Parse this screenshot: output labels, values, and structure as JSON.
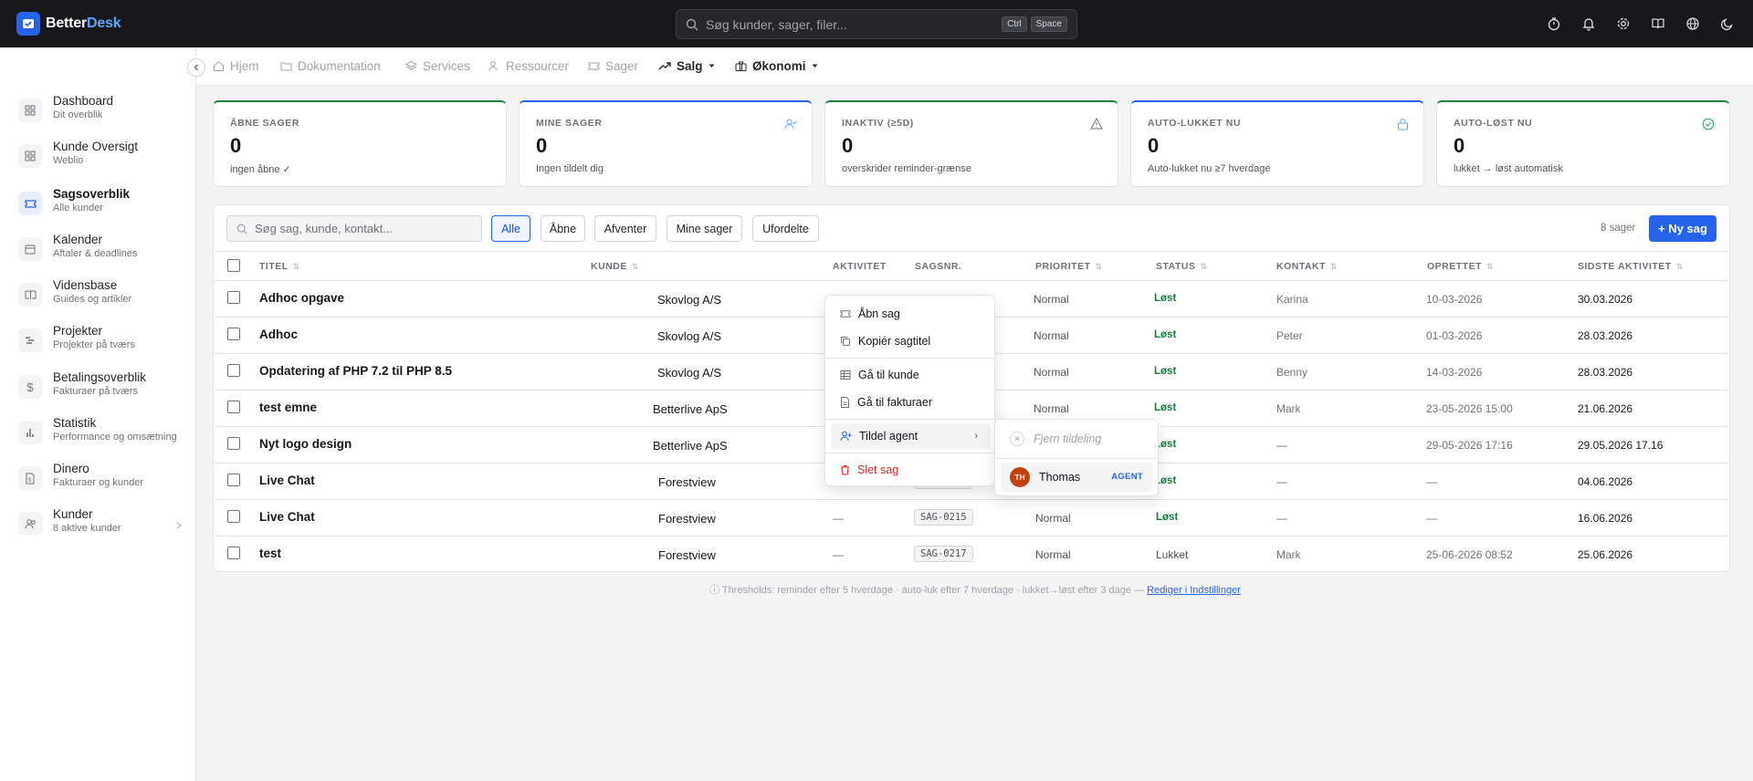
{
  "app": {
    "logo_text_a": "Better",
    "logo_text_b": "Desk",
    "accent_color": "#2563eb"
  },
  "topbar": {
    "search_placeholder": "Søg kunder, sager, filer...",
    "kbd1": "Ctrl",
    "kbd2": "Space",
    "icons": [
      "timer-icon",
      "bell-icon",
      "gear-icon",
      "book-icon",
      "globe-icon",
      "moon-icon"
    ]
  },
  "sidebar": {
    "items": [
      {
        "title": "Dashboard",
        "sub": "Dit overblik",
        "icon": "grid-icon"
      },
      {
        "title": "Kunde Oversigt",
        "sub": "Weblio",
        "icon": "grid-icon"
      },
      {
        "title": "Sagsoverblik",
        "sub": "Alle kunder",
        "icon": "ticket-icon",
        "active": true
      },
      {
        "title": "Kalender",
        "sub": "Aftaler & deadlines",
        "icon": "calendar-icon"
      },
      {
        "title": "Vidensbase",
        "sub": "Guides og artikler",
        "icon": "book-icon"
      },
      {
        "title": "Projekter",
        "sub": "Projekter på tværs",
        "icon": "gantt-icon"
      },
      {
        "title": "Betalingsoverblik",
        "sub": "Fakturaer på tværs",
        "icon": "dollar-icon"
      },
      {
        "title": "Statistik",
        "sub": "Performance og omsætning",
        "icon": "chart-icon"
      },
      {
        "title": "Dinero",
        "sub": "Fakturaer og kunder",
        "icon": "file-dollar-icon"
      },
      {
        "title": "Kunder",
        "sub": "8 aktive kunder",
        "icon": "users-icon"
      }
    ]
  },
  "navbar": {
    "items": [
      "Hjem",
      "Dokumentation",
      "Services",
      "Ressourcer",
      "Sager",
      "Salg",
      "Økonomi"
    ]
  },
  "cards": [
    {
      "label": "ÅBNE SAGER",
      "value": "0",
      "sub": "ingen åbne ✓"
    },
    {
      "label": "MINE SAGER",
      "value": "0",
      "sub": "Ingen tildelt dig"
    },
    {
      "label": "INAKTIV (≥5D)",
      "value": "0",
      "sub": "overskrider reminder-grænse"
    },
    {
      "label": "AUTO-LUKKET NU",
      "value": "0",
      "sub": "Auto-lukket nu ≥7 hverdage"
    },
    {
      "label": "AUTO-LØST NU",
      "value": "0",
      "sub": "lukket → løst automatisk"
    }
  ],
  "table": {
    "search_placeholder": "Søg sag, kunde, kontakt...",
    "filters": [
      "Alle",
      "Åbne",
      "Afventer",
      "Mine sager",
      "Ufordelte"
    ],
    "count": "8 sager",
    "new_button": "+ Ny sag",
    "headers": [
      "TITEL",
      "KUNDE",
      "AKTIVITET",
      "SAGSNR.",
      "PRIORITET",
      "STATUS",
      "KONTAKT",
      "OPRETTET",
      "SIDSTE AKTIVITET"
    ],
    "rows": [
      {
        "title": "Adhoc opgave",
        "kunde": "Skovlog A/S",
        "aktivitet": "",
        "sagnr": "",
        "prioritet": "Normal",
        "status": "Løst",
        "kontakt": "Karina",
        "oprettet": "10-03-2026",
        "sidste": "30.03.2026"
      },
      {
        "title": "Adhoc",
        "kunde": "Skovlog A/S",
        "aktivitet": "",
        "sagnr": "",
        "prioritet": "Normal",
        "status": "Løst",
        "kontakt": "Peter",
        "oprettet": "01-03-2026",
        "sidste": "28.03.2026"
      },
      {
        "title": "Opdatering af PHP 7.2 til PHP 8.5",
        "kunde": "Skovlog A/S",
        "aktivitet": "",
        "sagnr": "",
        "prioritet": "Normal",
        "status": "Løst",
        "kontakt": "Benny",
        "oprettet": "14-03-2026",
        "sidste": "28.03.2026"
      },
      {
        "title": "test emne",
        "kunde": "Betterlive ApS",
        "aktivitet": "",
        "sagnr": "",
        "prioritet": "Normal",
        "status": "Løst",
        "kontakt": "Mark",
        "oprettet": "23-05-2026 15:00",
        "sidste": "21.06.2026"
      },
      {
        "title": "Nyt logo design",
        "kunde": "Betterlive ApS",
        "aktivitet": "",
        "sagnr": "",
        "prioritet": "",
        "status": "Løst",
        "kontakt": "—",
        "oprettet": "29-05-2026 17:16",
        "sidste": "29.05.2026 17.16"
      },
      {
        "title": "Live Chat",
        "kunde": "Forestview",
        "aktivitet": "",
        "sagnr": "",
        "prioritet": "",
        "status": "Løst",
        "kontakt": "—",
        "oprettet": "—",
        "sidste": "04.06.2026"
      },
      {
        "title": "Live Chat",
        "kunde": "Forestview",
        "aktivitet": "—",
        "sagnr": "SAG-0215",
        "prioritet": "Normal",
        "status": "Løst",
        "kontakt": "—",
        "oprettet": "—",
        "sidste": "16.06.2026"
      },
      {
        "title": "test",
        "kunde": "Forestview",
        "aktivitet": "—",
        "sagnr": "SAG-0217",
        "prioritet": "Normal",
        "status": "Lukket",
        "kontakt": "Mark",
        "oprettet": "25-06-2026 08:52",
        "sidste": "25.06.2026"
      }
    ]
  },
  "footer": {
    "text": "Thresholds: reminder efter 5 hverdage · auto-luk efter 7 hverdage · lukket→løst efter 3 dage —",
    "link": "Rediger i Indstillinger"
  },
  "context_menu": {
    "items": [
      "Åbn sag",
      "Kopiér sagtitel",
      "Gå til kunde",
      "Gå til fakturaer",
      "Tildel agent",
      "Slet sag"
    ],
    "submenu": {
      "remove": "Fjern tildeling",
      "agent_initials": "TH",
      "agent_name": "Thomas",
      "agent_badge": "AGENT"
    }
  }
}
